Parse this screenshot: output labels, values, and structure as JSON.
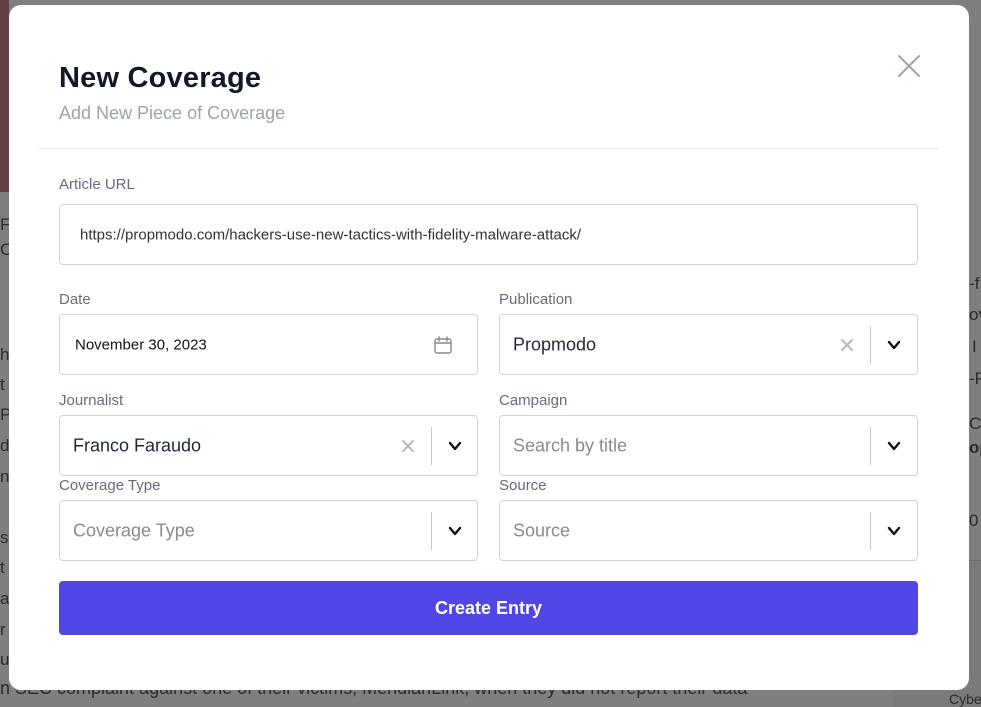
{
  "background": {
    "bottom_text": "n SEC complaint against one of their victims, MeridianLink, when they did not report their data",
    "right_fragments": [
      "-f",
      "ov",
      "I",
      "-P",
      "C",
      "op",
      "0"
    ],
    "left_fragments": [
      "F",
      "C",
      "h",
      "t",
      "P",
      "d",
      "n",
      "st",
      "t",
      "a",
      "r",
      "us"
    ],
    "right_card_text": "Cybe"
  },
  "modal": {
    "title": "New Coverage",
    "subtitle": "Add New Piece of Coverage",
    "close_icon": "close-icon"
  },
  "form": {
    "article_url": {
      "label": "Article URL",
      "value": "https://propmodo.com/hackers-use-new-tactics-with-fidelity-malware-attack/"
    },
    "date": {
      "label": "Date",
      "value": "November 30, 2023",
      "icon": "calendar-icon"
    },
    "publication": {
      "label": "Publication",
      "value": "Propmodo"
    },
    "journalist": {
      "label": "Journalist",
      "value": "Franco Faraudo"
    },
    "campaign": {
      "label": "Campaign",
      "placeholder": "Search by title"
    },
    "coverage_type": {
      "label": "Coverage Type",
      "placeholder": "Coverage Type"
    },
    "source": {
      "label": "Source",
      "placeholder": "Source"
    },
    "submit_label": "Create Entry"
  },
  "colors": {
    "primary": "#4f46e5",
    "label": "#6b6880",
    "border": "#d1d5db",
    "placeholder": "#8a8a8a"
  }
}
